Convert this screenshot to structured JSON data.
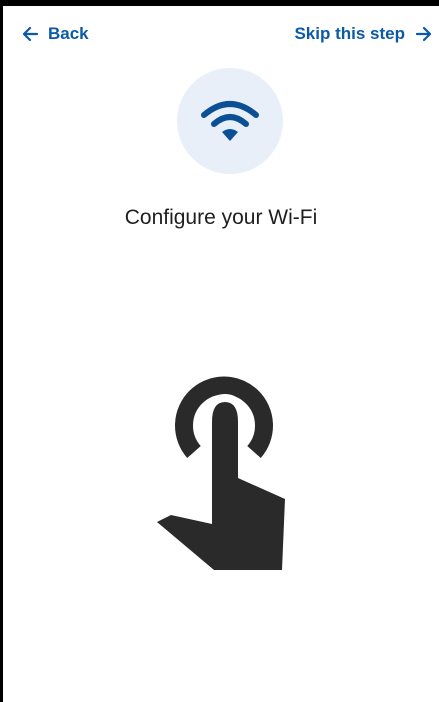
{
  "colors": {
    "accent": "#0b5aa8",
    "wifi_icon": "#0b4f94",
    "icon_circle_bg": "#e9eff8",
    "text": "#1f1f1f",
    "hand": "#2a2a2a"
  },
  "header": {
    "back_label": "Back",
    "back_icon": "arrow-left-icon",
    "skip_label": "Skip this step",
    "skip_icon": "arrow-right-icon"
  },
  "main": {
    "hero_icon": "wifi-icon",
    "title": "Configure your Wi-Fi",
    "illustration_icon": "tap-gesture-icon"
  }
}
